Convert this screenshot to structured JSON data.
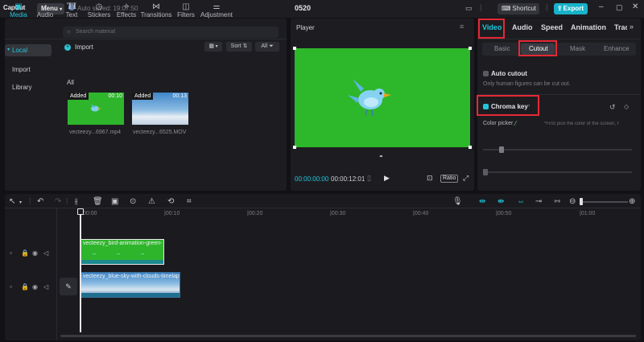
{
  "app": {
    "logo": "CapCut",
    "menu_label": "Menu",
    "autosave": "Auto saved: 19:07:50",
    "project_title": "0520",
    "shortcut_label": "Shortcut",
    "export_label": "Export"
  },
  "media_panel": {
    "tabs": [
      {
        "label": "Media",
        "icon": "media-icon"
      },
      {
        "label": "Audio",
        "icon": "audio-icon"
      },
      {
        "label": "Text",
        "icon": "text-icon"
      },
      {
        "label": "Stickers",
        "icon": "stickers-icon"
      },
      {
        "label": "Effects",
        "icon": "effects-icon"
      },
      {
        "label": "Transitions",
        "icon": "transitions-icon"
      },
      {
        "label": "Filters",
        "icon": "filters-icon"
      },
      {
        "label": "Adjustment",
        "icon": "adjustment-icon"
      }
    ],
    "sidebar": [
      "Local",
      "Import",
      "Library"
    ],
    "search_placeholder": "Search material",
    "import_label": "Import",
    "sort_label": "Sort",
    "filter_label": "All",
    "section_label": "All",
    "items": [
      {
        "badge": "Added",
        "duration": "00:10",
        "name": "vecteezy...6967.mp4"
      },
      {
        "badge": "Added",
        "duration": "00:13",
        "name": "vecteezy...6525.MOV"
      }
    ]
  },
  "player": {
    "title": "Player",
    "current_time": "00:00:00:00",
    "total_time": "00:00:12:01",
    "ratio_label": "Ratio"
  },
  "properties": {
    "tabs": [
      "Video",
      "Audio",
      "Speed",
      "Animation",
      "Trac"
    ],
    "subtabs": [
      "Basic",
      "Cutout",
      "Mask",
      "Enhance"
    ],
    "auto_cutout_label": "Auto cutout",
    "auto_cutout_hint": "Only human figures can be cut out.",
    "chroma_key_label": "Chroma key",
    "color_picker_label": "Color picker",
    "color_picker_hint": "*First pick the color of the screen, t"
  },
  "timeline": {
    "ruler": [
      "00:00",
      "|00:10",
      "|00:20",
      "|00:30",
      "|00:40",
      "|00:50",
      "|01:00"
    ],
    "clips": [
      {
        "name": "vecteezy_bird-animation-green-"
      },
      {
        "name": "vecteezy_blue-sky-with-clouds-timelap"
      }
    ]
  },
  "colors": {
    "accent": "#22c4dc",
    "highlight_box": "#e52935",
    "green_screen": "#2db72a",
    "export_button": "#17b3c9"
  }
}
